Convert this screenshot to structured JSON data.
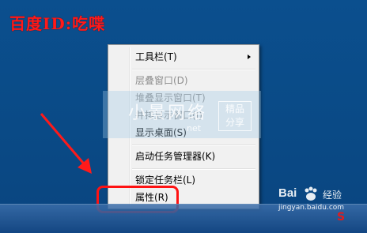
{
  "watermark": {
    "title": "百度ID:吃喋"
  },
  "context_menu": {
    "items": [
      {
        "label": "工具栏(T)",
        "disabled": false,
        "submenu": true
      },
      {
        "label": "层叠窗口(D)",
        "disabled": true
      },
      {
        "label": "堆叠显示窗口(T)",
        "disabled": true
      },
      {
        "label": "并排显示窗口(I)",
        "disabled": true
      },
      {
        "label": "显示桌面(S)",
        "disabled": false
      },
      {
        "label": "启动任务管理器(K)",
        "disabled": false
      },
      {
        "label": "锁定任务栏(L)",
        "disabled": false
      },
      {
        "label": "属性(R)",
        "disabled": false
      }
    ]
  },
  "overlay": {
    "brand": "小景网络",
    "badge_line1": "精品",
    "badge_line2": "分享",
    "sub": "net"
  },
  "baidu_jingyan": {
    "logo": "Bai",
    "label": "经验",
    "url": "jingyan.baidu.com"
  },
  "tray": {
    "ime": "S"
  },
  "colors": {
    "desktop": "#0a4a86",
    "annotation_red": "#ff1212",
    "menu_bg": "#f1f1f1"
  },
  "icons": [
    "arrow-annotation-icon",
    "submenu-arrow-icon",
    "baidu-paw-icon",
    "sogou-ime-icon"
  ]
}
